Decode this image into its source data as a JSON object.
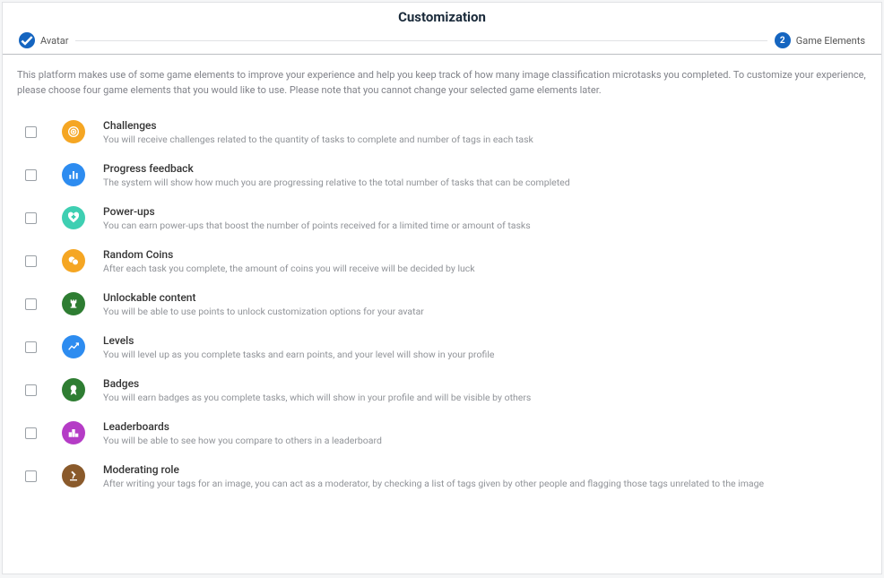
{
  "page_title": "Customization",
  "steps": {
    "step1": {
      "label": "Avatar",
      "badge": "✓"
    },
    "step2": {
      "label": "Game Elements",
      "badge": "2"
    }
  },
  "intro": "This platform makes use of some game elements to improve your experience and help you keep track of how many image classification microtasks you completed. To customize your experience, please choose four game elements that you would like to use. Please note that you cannot change your selected game elements later.",
  "elements": [
    {
      "key": "challenges",
      "title": "Challenges",
      "desc": "You will receive challenges related to the quantity of tasks to complete and number of tags in each task",
      "color": "#f5a623"
    },
    {
      "key": "progress",
      "title": "Progress feedback",
      "desc": "The system will show how much you are progressing relative to the total number of tasks that can be completed",
      "color": "#2d8cf0"
    },
    {
      "key": "powerups",
      "title": "Power-ups",
      "desc": "You can earn power-ups that boost the number of points received for a limited time or amount of tasks",
      "color": "#3ecfb2"
    },
    {
      "key": "randomcoins",
      "title": "Random Coins",
      "desc": "After each task you complete, the amount of coins you will receive will be decided by luck",
      "color": "#f5a623"
    },
    {
      "key": "unlockable",
      "title": "Unlockable content",
      "desc": "You will be able to use points to unlock customization options for your avatar",
      "color": "#2e7d32"
    },
    {
      "key": "levels",
      "title": "Levels",
      "desc": "You will level up as you complete tasks and earn points, and your level will show in your profile",
      "color": "#2d8cf0"
    },
    {
      "key": "badges",
      "title": "Badges",
      "desc": "You will earn badges as you complete tasks, which will show in your profile and will be visible by others",
      "color": "#2e7d32"
    },
    {
      "key": "leaderboards",
      "title": "Leaderboards",
      "desc": "You will be able to see how you compare to others in a leaderboard",
      "color": "#b53cc6"
    },
    {
      "key": "moderating",
      "title": "Moderating role",
      "desc": "After writing your tags for an image, you can act as a moderator, by checking a list of tags given by other people and flagging those tags unrelated to the image",
      "color": "#8a5a2b"
    }
  ]
}
